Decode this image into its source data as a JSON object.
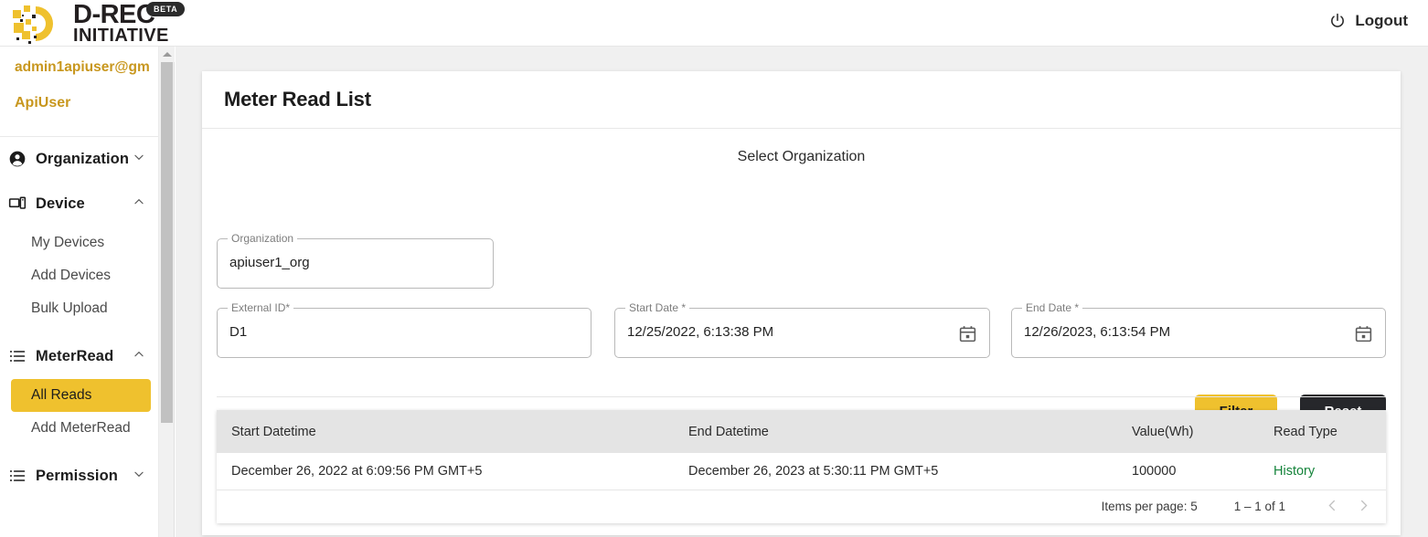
{
  "brand": {
    "name_primary": "D-REC",
    "name_secondary": "INITIATIVE",
    "badge": "BETA",
    "accent_color": "#EFC12E",
    "logo_icon": "drec-logo-icon"
  },
  "topbar": {
    "logout_label": "Logout",
    "logout_icon": "power-icon"
  },
  "sidebar": {
    "user_email": "admin1apiuser@gm",
    "user_name": "ApiUser",
    "groups": [
      {
        "label": "Organization",
        "icon": "account-circle-icon",
        "chevron": "chevron-down-icon",
        "expanded": false,
        "items": []
      },
      {
        "label": "Device",
        "icon": "device-icon",
        "chevron": "chevron-up-icon",
        "expanded": true,
        "items": [
          {
            "label": "My Devices",
            "active": false
          },
          {
            "label": "Add Devices",
            "active": false
          },
          {
            "label": "Bulk Upload",
            "active": false
          }
        ]
      },
      {
        "label": "MeterRead",
        "icon": "list-icon",
        "chevron": "chevron-up-icon",
        "expanded": true,
        "items": [
          {
            "label": "All Reads",
            "active": true
          },
          {
            "label": "Add MeterRead",
            "active": false
          }
        ]
      },
      {
        "label": "Permission",
        "icon": "list-icon",
        "chevron": "chevron-down-icon",
        "expanded": false,
        "items": []
      }
    ]
  },
  "page": {
    "title": "Meter Read List",
    "section_label": "Select Organization"
  },
  "form": {
    "organization": {
      "label": "Organization",
      "value": "apiuser1_org",
      "placeholder": ""
    },
    "external_id": {
      "label": "External ID*",
      "value": "D1",
      "placeholder": ""
    },
    "start_date": {
      "label": "Start Date *",
      "value": "12/25/2022, 6:13:38 PM",
      "icon": "calendar-icon"
    },
    "end_date": {
      "label": "End Date *",
      "value": "12/26/2023, 6:13:54 PM",
      "icon": "calendar-icon"
    },
    "filter_label": "Filter",
    "reset_label": "Reset"
  },
  "table": {
    "columns": [
      "Start Datetime",
      "End Datetime",
      "Value(Wh)",
      "Read Type"
    ],
    "rows": [
      {
        "start_datetime": "December 26, 2022 at 6:09:56 PM GMT+5",
        "end_datetime": "December 26, 2023 at 5:30:11 PM GMT+5",
        "value_wh": "100000",
        "read_type": "History"
      }
    ]
  },
  "paginator": {
    "items_per_page_label": "Items per page: 5",
    "range_label": "1 – 1 of 1",
    "prev_icon": "chevron-left-icon",
    "next_icon": "chevron-right-icon"
  }
}
